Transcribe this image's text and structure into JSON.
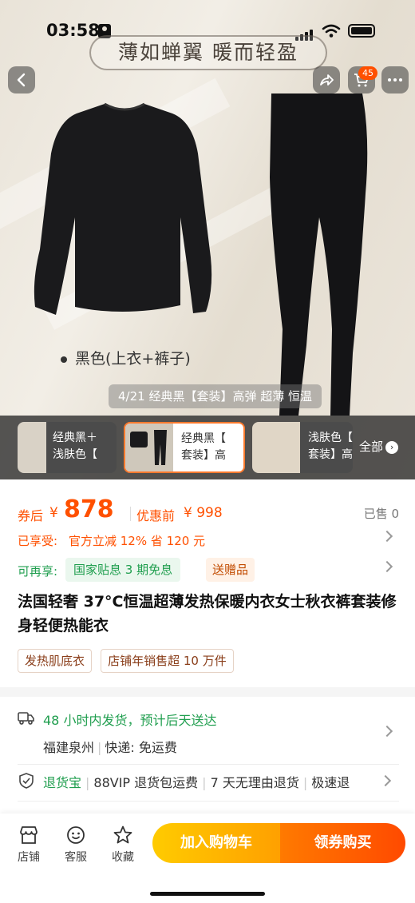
{
  "status_bar": {
    "time": "03:58"
  },
  "hero": {
    "banner": "薄如蝉翼  暖而轻盈",
    "garment_label": "黑色(上衣+裤子)",
    "caption": "4/21 经典黑【套装】高弹 超薄 恒温",
    "cart_count": "45"
  },
  "sku_strip": {
    "items": [
      {
        "line1": "经典黑＋",
        "line2": "浅肤色【"
      },
      {
        "line1": "经典黑【",
        "line2": "套装】高"
      },
      {
        "line1": "浅肤色【",
        "line2": "套装】高"
      }
    ],
    "all_label": "全部"
  },
  "price": {
    "prefix": "券后",
    "currency": "¥",
    "value": "878",
    "orig_label": "优惠前",
    "orig_value": "¥ 998",
    "sold": "已售 0"
  },
  "promos": {
    "enjoyed_label": "已享受:",
    "enjoyed_text": "官方立减 12% 省 120 元",
    "more_label": "可再享:",
    "more_tag1": "国家贴息 3 期免息",
    "more_tag2": "送赠品"
  },
  "product": {
    "title": "法国轻奢 37°C恒温超薄发热保暖内衣女士秋衣裤套装修身轻便热能衣",
    "tags": [
      "发热肌底衣",
      "店铺年销售超 10 万件"
    ]
  },
  "delivery": {
    "main": "48 小时内发货，预计后天送达",
    "origin": "福建泉州",
    "courier": "快递: 免运费"
  },
  "guarantee": {
    "items": [
      "退货宝",
      "88VIP 退货包运费",
      "7 天无理由退货",
      "极速退"
    ]
  },
  "bottom_bar": {
    "store": "店铺",
    "service": "客服",
    "favorite": "收藏",
    "add_cart": "加入购物车",
    "buy": "领券购买"
  },
  "colors": {
    "accent": "#ff5000",
    "green": "#1f9e4e"
  }
}
